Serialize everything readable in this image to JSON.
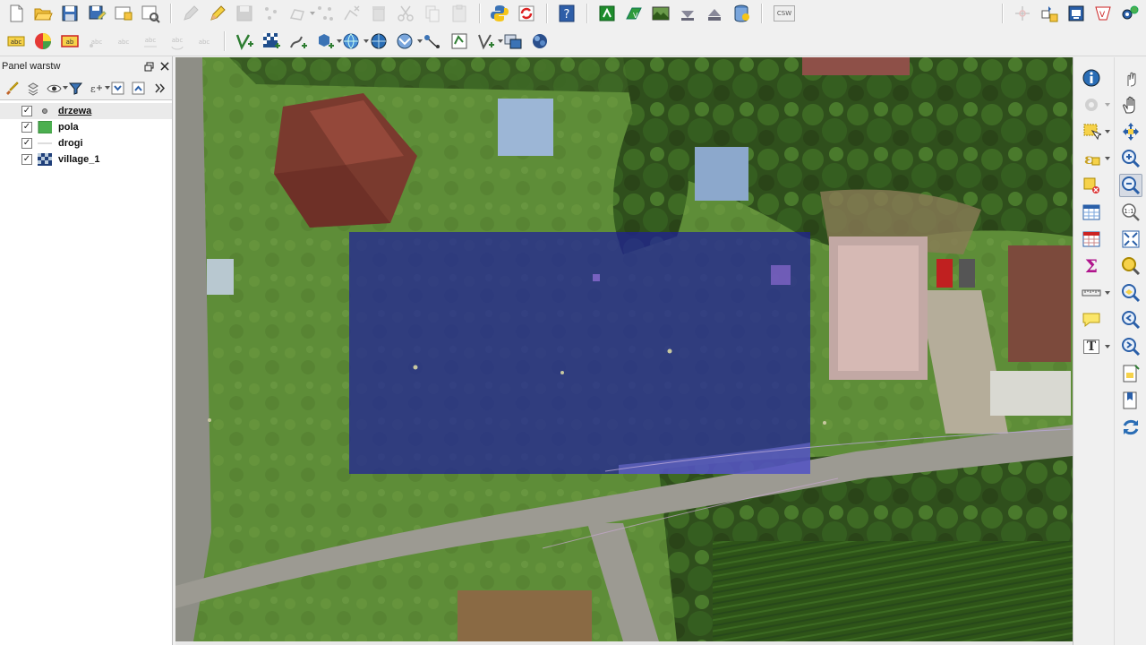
{
  "layers_panel": {
    "title": "Panel warstw",
    "layers": [
      {
        "name": "drzewa",
        "checked": true,
        "symbol": "point",
        "selected": true
      },
      {
        "name": "pola",
        "checked": true,
        "symbol": "polygon"
      },
      {
        "name": "drogi",
        "checked": true,
        "symbol": "line"
      },
      {
        "name": "village_1",
        "checked": true,
        "symbol": "raster"
      }
    ]
  },
  "toolbar": {
    "csw_label": "CSW"
  },
  "colors": {
    "polygon_fill": "#1f1f9a",
    "polygon_layer_symbol": "#4caf50",
    "accent_blue": "#2a5fa8",
    "road": "#9a9a9a",
    "grass": "#5f8f3a"
  }
}
